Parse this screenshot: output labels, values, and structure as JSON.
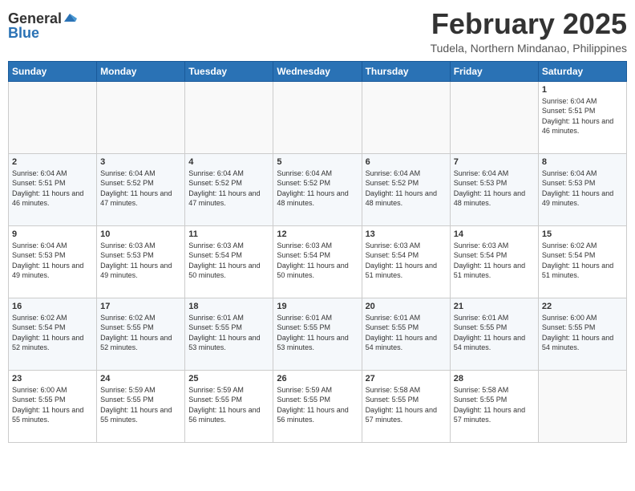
{
  "header": {
    "logo_general": "General",
    "logo_blue": "Blue",
    "month_year": "February 2025",
    "location": "Tudela, Northern Mindanao, Philippines"
  },
  "weekdays": [
    "Sunday",
    "Monday",
    "Tuesday",
    "Wednesday",
    "Thursday",
    "Friday",
    "Saturday"
  ],
  "weeks": [
    [
      {
        "day": "",
        "info": ""
      },
      {
        "day": "",
        "info": ""
      },
      {
        "day": "",
        "info": ""
      },
      {
        "day": "",
        "info": ""
      },
      {
        "day": "",
        "info": ""
      },
      {
        "day": "",
        "info": ""
      },
      {
        "day": "1",
        "info": "Sunrise: 6:04 AM\nSunset: 5:51 PM\nDaylight: 11 hours and 46 minutes."
      }
    ],
    [
      {
        "day": "2",
        "info": "Sunrise: 6:04 AM\nSunset: 5:51 PM\nDaylight: 11 hours and 46 minutes."
      },
      {
        "day": "3",
        "info": "Sunrise: 6:04 AM\nSunset: 5:52 PM\nDaylight: 11 hours and 47 minutes."
      },
      {
        "day": "4",
        "info": "Sunrise: 6:04 AM\nSunset: 5:52 PM\nDaylight: 11 hours and 47 minutes."
      },
      {
        "day": "5",
        "info": "Sunrise: 6:04 AM\nSunset: 5:52 PM\nDaylight: 11 hours and 48 minutes."
      },
      {
        "day": "6",
        "info": "Sunrise: 6:04 AM\nSunset: 5:52 PM\nDaylight: 11 hours and 48 minutes."
      },
      {
        "day": "7",
        "info": "Sunrise: 6:04 AM\nSunset: 5:53 PM\nDaylight: 11 hours and 48 minutes."
      },
      {
        "day": "8",
        "info": "Sunrise: 6:04 AM\nSunset: 5:53 PM\nDaylight: 11 hours and 49 minutes."
      }
    ],
    [
      {
        "day": "9",
        "info": "Sunrise: 6:04 AM\nSunset: 5:53 PM\nDaylight: 11 hours and 49 minutes."
      },
      {
        "day": "10",
        "info": "Sunrise: 6:03 AM\nSunset: 5:53 PM\nDaylight: 11 hours and 49 minutes."
      },
      {
        "day": "11",
        "info": "Sunrise: 6:03 AM\nSunset: 5:54 PM\nDaylight: 11 hours and 50 minutes."
      },
      {
        "day": "12",
        "info": "Sunrise: 6:03 AM\nSunset: 5:54 PM\nDaylight: 11 hours and 50 minutes."
      },
      {
        "day": "13",
        "info": "Sunrise: 6:03 AM\nSunset: 5:54 PM\nDaylight: 11 hours and 51 minutes."
      },
      {
        "day": "14",
        "info": "Sunrise: 6:03 AM\nSunset: 5:54 PM\nDaylight: 11 hours and 51 minutes."
      },
      {
        "day": "15",
        "info": "Sunrise: 6:02 AM\nSunset: 5:54 PM\nDaylight: 11 hours and 51 minutes."
      }
    ],
    [
      {
        "day": "16",
        "info": "Sunrise: 6:02 AM\nSunset: 5:54 PM\nDaylight: 11 hours and 52 minutes."
      },
      {
        "day": "17",
        "info": "Sunrise: 6:02 AM\nSunset: 5:55 PM\nDaylight: 11 hours and 52 minutes."
      },
      {
        "day": "18",
        "info": "Sunrise: 6:01 AM\nSunset: 5:55 PM\nDaylight: 11 hours and 53 minutes."
      },
      {
        "day": "19",
        "info": "Sunrise: 6:01 AM\nSunset: 5:55 PM\nDaylight: 11 hours and 53 minutes."
      },
      {
        "day": "20",
        "info": "Sunrise: 6:01 AM\nSunset: 5:55 PM\nDaylight: 11 hours and 54 minutes."
      },
      {
        "day": "21",
        "info": "Sunrise: 6:01 AM\nSunset: 5:55 PM\nDaylight: 11 hours and 54 minutes."
      },
      {
        "day": "22",
        "info": "Sunrise: 6:00 AM\nSunset: 5:55 PM\nDaylight: 11 hours and 54 minutes."
      }
    ],
    [
      {
        "day": "23",
        "info": "Sunrise: 6:00 AM\nSunset: 5:55 PM\nDaylight: 11 hours and 55 minutes."
      },
      {
        "day": "24",
        "info": "Sunrise: 5:59 AM\nSunset: 5:55 PM\nDaylight: 11 hours and 55 minutes."
      },
      {
        "day": "25",
        "info": "Sunrise: 5:59 AM\nSunset: 5:55 PM\nDaylight: 11 hours and 56 minutes."
      },
      {
        "day": "26",
        "info": "Sunrise: 5:59 AM\nSunset: 5:55 PM\nDaylight: 11 hours and 56 minutes."
      },
      {
        "day": "27",
        "info": "Sunrise: 5:58 AM\nSunset: 5:55 PM\nDaylight: 11 hours and 57 minutes."
      },
      {
        "day": "28",
        "info": "Sunrise: 5:58 AM\nSunset: 5:55 PM\nDaylight: 11 hours and 57 minutes."
      },
      {
        "day": "",
        "info": ""
      }
    ]
  ]
}
